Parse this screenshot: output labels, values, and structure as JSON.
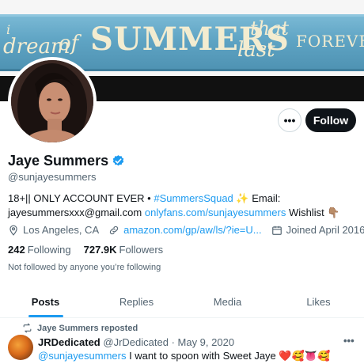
{
  "banner": {
    "line_i": "i",
    "line_dream": "dream",
    "line_of": "of",
    "line_summers": "SUMMERS",
    "line_that": "that",
    "line_last": "last",
    "line_forever": "FOREVER"
  },
  "profile": {
    "name": "Jaye Summers",
    "handle": "@sunjayesummers",
    "bio_text1": "18+|| ONLY ACCOUNT EVER • ",
    "bio_hashtag": "#SummersSquad",
    "bio_text2": " ✨ Email:",
    "bio_email": "jayesummersxxx@gmail.com",
    "bio_link": "onlyfans.com/sunjayesummers",
    "bio_text3": " Wishlist 👇🏽",
    "location": "Los Angeles, CA",
    "website": "amazon.com/gp/aw/ls/?ie=U...",
    "joined": "Joined April 2016",
    "following_count": "242",
    "following_label": "Following",
    "followers_count": "727.9K",
    "followers_label": "Followers",
    "not_followed": "Not followed by anyone you’re following"
  },
  "actions": {
    "more_label": "•••",
    "follow_label": "Follow"
  },
  "tabs": [
    {
      "label": "Posts"
    },
    {
      "label": "Replies"
    },
    {
      "label": "Media"
    },
    {
      "label": "Likes"
    }
  ],
  "tweet": {
    "repost_label": "Jaye Summers reposted",
    "author_name": "JRDedicated",
    "author_handle": "@JrDedicated",
    "date": " · May 9, 2020",
    "mention": "@sunjayesummers",
    "text": " I want to spoon with Sweet Jaye ❤️🥰👅🥰",
    "more_label": "•••"
  },
  "colors": {
    "accent": "#1d9bf0",
    "text": "#0f1419",
    "muted": "#536471"
  },
  "icons": {
    "verified": "verified-badge-icon",
    "location": "location-pin-icon",
    "link": "link-icon",
    "calendar": "calendar-icon",
    "repost": "repost-icon"
  }
}
